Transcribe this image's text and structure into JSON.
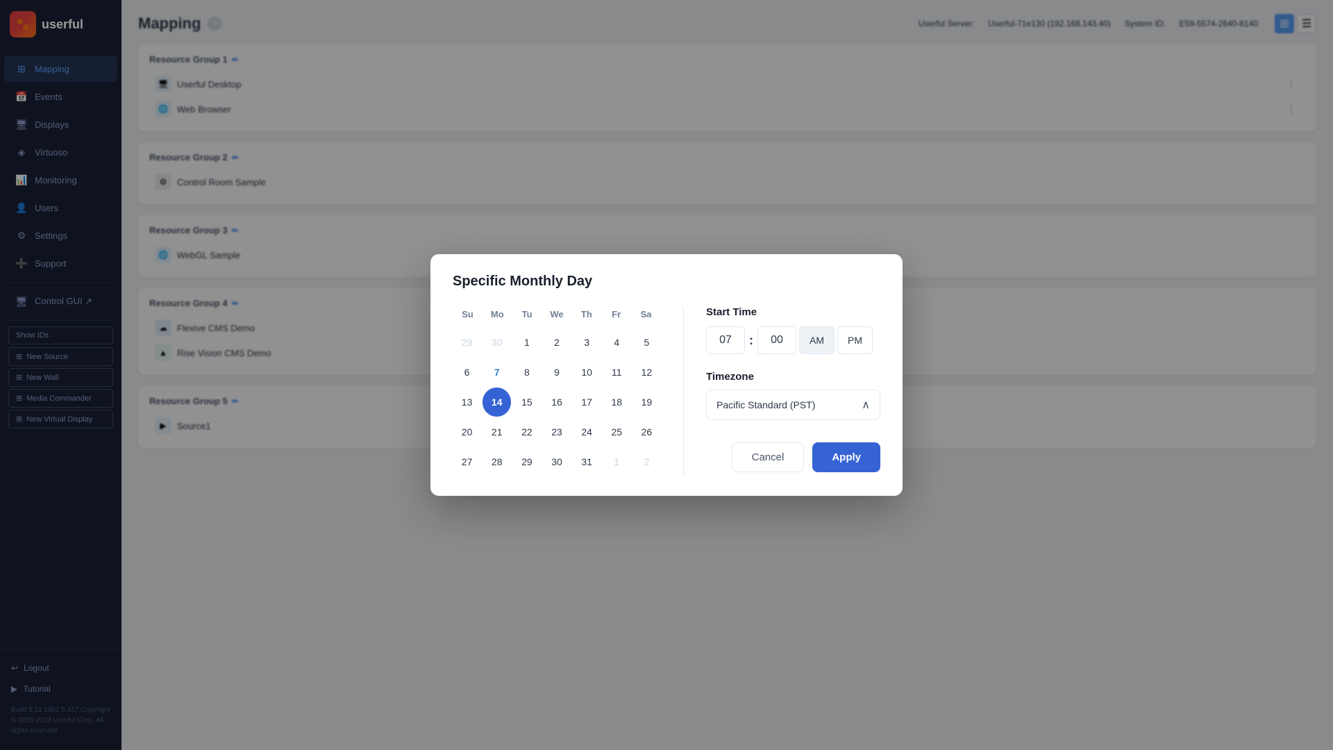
{
  "sidebar": {
    "logo_text": "userful",
    "nav_items": [
      {
        "id": "mapping",
        "label": "Mapping",
        "icon": "⊞",
        "active": true
      },
      {
        "id": "events",
        "label": "Events",
        "icon": "📅",
        "active": false
      },
      {
        "id": "displays",
        "label": "Displays",
        "icon": "🖥",
        "active": false
      },
      {
        "id": "virtuoso",
        "label": "Virtuoso",
        "icon": "◈",
        "active": false
      },
      {
        "id": "monitoring",
        "label": "Monitoring",
        "icon": "📊",
        "active": false
      },
      {
        "id": "users",
        "label": "Users",
        "icon": "👤",
        "active": false
      },
      {
        "id": "settings",
        "label": "Settings",
        "icon": "⚙",
        "active": false
      },
      {
        "id": "support",
        "label": "Support",
        "icon": "➕",
        "active": false
      }
    ],
    "control_gui": "Control GUI ↗",
    "show_ids": "Show IDs",
    "action_buttons": [
      {
        "id": "new-source",
        "label": "New Source"
      },
      {
        "id": "new-wall",
        "label": "New Wall"
      },
      {
        "id": "media-commander",
        "label": "Media Commander"
      },
      {
        "id": "new-virtual-display",
        "label": "New Virtual Display"
      }
    ],
    "logout_label": "Logout",
    "tutorial_label": "Tutorial",
    "build_info": "Build 5.12 1962 5.417\nCopyright © 2005-2023 Userful Corp.\nAll rights reserved."
  },
  "header": {
    "title": "Mapping",
    "server_label": "Userful Server:",
    "server_value": "Userful-71e130 (192.168.143.40)",
    "system_label": "System ID:",
    "system_value": "E59-5574-2640-8140"
  },
  "resource_groups": [
    {
      "id": "rg1",
      "label": "Resource Group 1",
      "items": [
        {
          "name": "Userful Desktop",
          "icon": "🖥",
          "icon_bg": "#e8f4fd"
        },
        {
          "name": "Web Browser",
          "icon": "🌐",
          "icon_bg": "#e8f4fd"
        }
      ]
    },
    {
      "id": "rg2",
      "label": "Resource Group 2",
      "items": [
        {
          "name": "Control Room Sample",
          "icon": "⚙",
          "icon_bg": "#eee"
        }
      ]
    },
    {
      "id": "rg3",
      "label": "Resource Group 3",
      "items": [
        {
          "name": "WebGL Sample",
          "icon": "🌐",
          "icon_bg": "#e8f4fd"
        }
      ]
    },
    {
      "id": "rg4",
      "label": "Resource Group 4",
      "items": [
        {
          "name": "Flexive CMS Demo",
          "icon": "☁",
          "icon_bg": "#e3f0fb"
        },
        {
          "name": "Rise Vision CMS Demo",
          "icon": "▲",
          "icon_bg": "#e8f8ee"
        }
      ]
    },
    {
      "id": "rg5",
      "label": "Resource Group 5",
      "items": [
        {
          "name": "Source1",
          "icon": "▶",
          "icon_bg": "#e8f4fd"
        }
      ]
    }
  ],
  "dialog": {
    "title": "Specific Monthly Day",
    "calendar": {
      "day_names": [
        "Su",
        "Mo",
        "Tu",
        "We",
        "Th",
        "Fr",
        "Sa"
      ],
      "weeks": [
        [
          {
            "num": "29",
            "type": "disabled"
          },
          {
            "num": "30",
            "type": "disabled"
          },
          {
            "num": "1",
            "type": "normal"
          },
          {
            "num": "2",
            "type": "normal"
          },
          {
            "num": "3",
            "type": "normal"
          },
          {
            "num": "4",
            "type": "normal"
          },
          {
            "num": "5",
            "type": "normal"
          }
        ],
        [
          {
            "num": "6",
            "type": "normal"
          },
          {
            "num": "7",
            "type": "today"
          },
          {
            "num": "8",
            "type": "normal"
          },
          {
            "num": "9",
            "type": "normal"
          },
          {
            "num": "10",
            "type": "normal"
          },
          {
            "num": "11",
            "type": "normal"
          },
          {
            "num": "12",
            "type": "normal"
          }
        ],
        [
          {
            "num": "13",
            "type": "normal"
          },
          {
            "num": "14",
            "type": "selected"
          },
          {
            "num": "15",
            "type": "normal"
          },
          {
            "num": "16",
            "type": "normal"
          },
          {
            "num": "17",
            "type": "normal"
          },
          {
            "num": "18",
            "type": "normal"
          },
          {
            "num": "19",
            "type": "normal"
          }
        ],
        [
          {
            "num": "20",
            "type": "normal"
          },
          {
            "num": "21",
            "type": "normal"
          },
          {
            "num": "22",
            "type": "normal"
          },
          {
            "num": "23",
            "type": "normal"
          },
          {
            "num": "24",
            "type": "normal"
          },
          {
            "num": "25",
            "type": "normal"
          },
          {
            "num": "26",
            "type": "normal"
          }
        ],
        [
          {
            "num": "27",
            "type": "normal"
          },
          {
            "num": "28",
            "type": "normal"
          },
          {
            "num": "29",
            "type": "normal"
          },
          {
            "num": "30",
            "type": "normal"
          },
          {
            "num": "31",
            "type": "normal"
          },
          {
            "num": "1",
            "type": "disabled"
          },
          {
            "num": "2",
            "type": "disabled"
          }
        ]
      ]
    },
    "start_time_label": "Start Time",
    "time_hour": "07",
    "time_minute": "00",
    "am_label": "AM",
    "pm_label": "PM",
    "active_ampm": "AM",
    "timezone_label": "Timezone",
    "timezone_value": "Pacific Standard (PST)",
    "cancel_label": "Cancel",
    "apply_label": "Apply"
  }
}
